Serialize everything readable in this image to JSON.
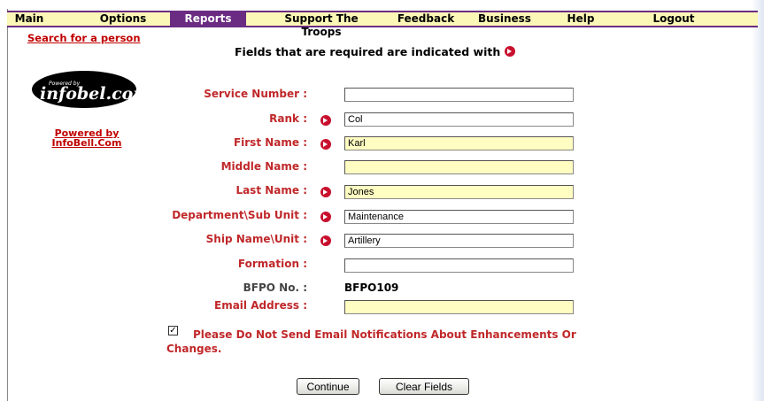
{
  "nav": {
    "items": [
      "Main",
      "Options",
      "Reports",
      "Support The Troops",
      "Feedback",
      "Business",
      "Help",
      "Logout"
    ],
    "active": "Reports",
    "accent_color": "#6a2c82",
    "bar_color": "#fbf7b6"
  },
  "sidebar": {
    "search_link": "Search for a person",
    "logo_text": "infobel.com",
    "logo_tagline": "Powered by",
    "powered_link": "Powered by InfoBell.Com"
  },
  "form": {
    "heading": "Fields that are required are indicated with",
    "fields": {
      "service_number": {
        "label": "Service Number :",
        "value": ""
      },
      "rank": {
        "label": "Rank :",
        "value": "Col"
      },
      "first_name": {
        "label": "First Name :",
        "value": "Karl"
      },
      "middle_name": {
        "label": "Middle Name :",
        "value": ""
      },
      "last_name": {
        "label": "Last Name :",
        "value": "Jones"
      },
      "department": {
        "label": "Department\\Sub Unit :",
        "value": "Maintenance"
      },
      "ship_name": {
        "label": "Ship Name\\Unit :",
        "value": "Artillery"
      },
      "formation": {
        "label": "Formation :",
        "value": ""
      },
      "bfpo": {
        "label": "BFPO No. :",
        "value": "BFPO109"
      },
      "email": {
        "label": "Email Address :",
        "value": ""
      }
    },
    "notify_checkbox": {
      "checked": true,
      "label_line1": "Please Do Not Send Email Notifications About Enhancements Or",
      "label_line2": "Changes."
    },
    "buttons": {
      "continue": "Continue",
      "clear": "Clear Fields"
    },
    "label_color": "#c0282a",
    "required_color": "#c8102e",
    "highlight_color": "#fffdc2"
  }
}
